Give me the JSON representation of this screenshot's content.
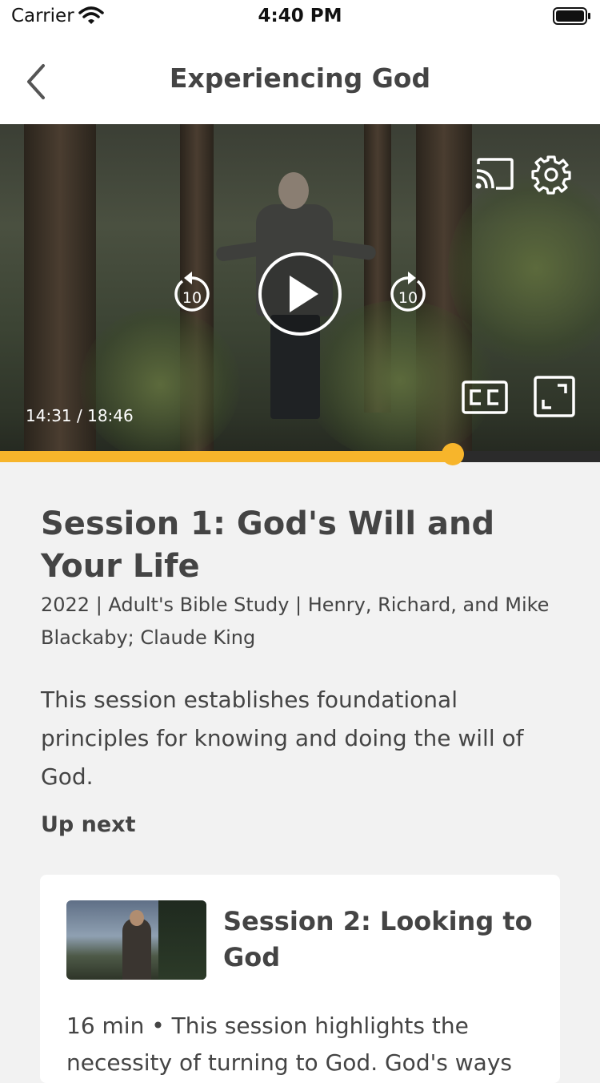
{
  "status_bar": {
    "carrier": "Carrier",
    "time": "4:40 PM"
  },
  "nav": {
    "title": "Experiencing God",
    "back_icon": "chevron-left-icon"
  },
  "video": {
    "time_readout": "14:31 / 18:46",
    "rewind_label": "10",
    "forward_label": "10",
    "progress_fraction": 0.754,
    "accent_color": "#f7b52b",
    "icons": [
      "cast-icon",
      "settings-gear-icon",
      "rewind-10-icon",
      "play-icon",
      "forward-10-icon",
      "closed-captions-icon",
      "fullscreen-icon"
    ]
  },
  "session": {
    "title": "Session 1: God's Will and Your Life",
    "meta": "2022 | Adult's Bible Study | Henry, Richard, and Mike Blackaby; Claude King",
    "description": "This session establishes foundational principles for knowing and doing the will of God."
  },
  "up_next": {
    "heading": "Up next",
    "title": "Session 2: Looking to God",
    "description": "16 min • This session highlights the necessity of turning to God. God's ways"
  }
}
